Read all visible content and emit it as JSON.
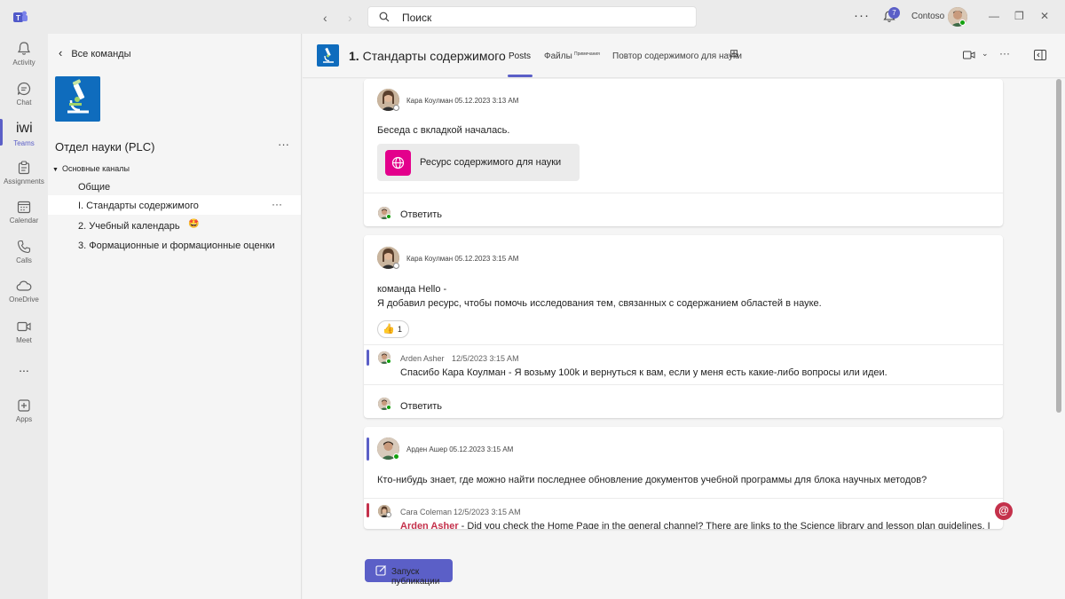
{
  "titlebar": {
    "search_placeholder": "Поиск",
    "notification_count": "7",
    "org_name": "Contoso"
  },
  "rail": {
    "items": [
      {
        "label": "Activity",
        "icon": "bell-icon"
      },
      {
        "label": "Chat",
        "icon": "chat-icon"
      },
      {
        "label": "Teams",
        "icon": "teams-icon",
        "glyph": "iwi"
      },
      {
        "label": "Assignments",
        "icon": "assignments-icon"
      },
      {
        "label": "Calendar",
        "icon": "calendar-icon"
      },
      {
        "label": "Calls",
        "icon": "phone-icon"
      },
      {
        "label": "OneDrive",
        "icon": "cloud-icon"
      },
      {
        "label": "Meet",
        "icon": "video-icon"
      },
      {
        "label": "Apps",
        "icon": "apps-icon"
      }
    ],
    "more": "..."
  },
  "panel": {
    "back_label": "Все команды",
    "team_name": "Отдел науки (PLC)",
    "section_label": "Основные каналы",
    "channels": [
      {
        "label": "Общие"
      },
      {
        "label": "I. Стандарты содержимого"
      },
      {
        "label": "2. Учебный календарь"
      },
      {
        "label": "3. Формационные и формационные оценки"
      }
    ]
  },
  "header": {
    "channel_number": "1.",
    "channel_title": "Стандарты содержимого",
    "tabs": [
      {
        "label": "Posts",
        "active": true
      },
      {
        "label": "Файлы"
      },
      {
        "label": "Повтор содержимого для науки"
      }
    ],
    "tab_sub": "Примечания"
  },
  "posts": [
    {
      "author_line": "Кара Коулман 05.12.2023 3:13 AM",
      "text": "Беседа с вкладкой началась.",
      "resource_label": "Ресурс содержимого для науки",
      "reply_label": "Ответить"
    },
    {
      "author_line": "Кара Коулман 05.12.2023 3:15 AM",
      "text_line1": "команда Hello -",
      "text_line2": "Я добавил ресурс, чтобы помочь исследования тем, связанных с содержанием областей в науке.",
      "reaction_count": "1",
      "reply_author": "Arden Asher",
      "reply_time": "12/5/2023 3:15 AM",
      "reply_text": "Спасибо Кара Коулман - Я возьму 100k и вернуться к вам, если у меня есть какие-либо вопросы или идеи.",
      "reply_label": "Ответить"
    },
    {
      "author_line": "Арден Ашер 05.12.2023 3:15 AM",
      "text": "Кто-нибудь знает, где можно найти последнее обновление документов учебной программы для блока научных методов?",
      "reply_author": "Cara Coleman",
      "reply_time": "12/5/2023 3:15 AM",
      "reply_mention": "Arden Asher",
      "reply_text": " - Did you check the Home Page in the general channel? There are links to the Science library and lesson plan guidelines. I"
    }
  ],
  "compose": {
    "post_button": "Запуск публикации"
  },
  "colors": {
    "accent": "#5b5fc7",
    "resource_icon": "#e3008c",
    "mention": "#c4314b",
    "presence": "#13a10e"
  }
}
